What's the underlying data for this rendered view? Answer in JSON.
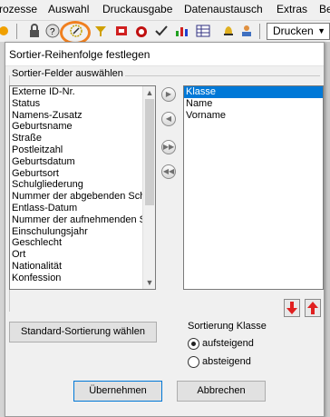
{
  "menu": {
    "items": [
      "rozesse",
      "Auswahl",
      "Druckausgabe",
      "Datenaustausch",
      "Extras",
      "Ber"
    ]
  },
  "toolbar": {
    "print_select_value": "Drucken",
    "icons": [
      "lock-icon",
      "question-icon",
      "sort-wizard-icon",
      "filter-icon",
      "print-preview-icon",
      "alarm-icon",
      "check-icon",
      "chart-icon",
      "table-icon",
      "bell-icon",
      "users-icon",
      "arrow-icon"
    ]
  },
  "dialog": {
    "title": "Sortier-Reihenfolge festlegen",
    "group_label": "Sortier-Felder auswählen",
    "available_fields": [
      "Externe ID-Nr.",
      "Status",
      "Namens-Zusatz",
      "Geburtsname",
      "Straße",
      "Postleitzahl",
      "Geburtsdatum",
      "Geburtsort",
      "Schulgliederung",
      "Nummer der abgebenden Sch",
      "Entlass-Datum",
      "Nummer der aufnehmenden S",
      "Einschulungsjahr",
      "Geschlecht",
      "Ort",
      "Nationalität",
      "Konfession"
    ],
    "selected_fields": [
      "Klasse",
      "Name",
      "Vorname"
    ],
    "selected_index": 0,
    "standard_sort_button": "Standard-Sortierung wählen",
    "sort_group_label": "Sortierung Klasse",
    "sort_options": [
      "aufsteigend",
      "absteigend"
    ],
    "sort_selected": "aufsteigend",
    "ok_button": "Übernehmen",
    "cancel_button": "Abbrechen"
  },
  "colors": {
    "selection": "#0078d7",
    "highlight_ring": "#f08020",
    "arrow_red": "#e02020"
  }
}
